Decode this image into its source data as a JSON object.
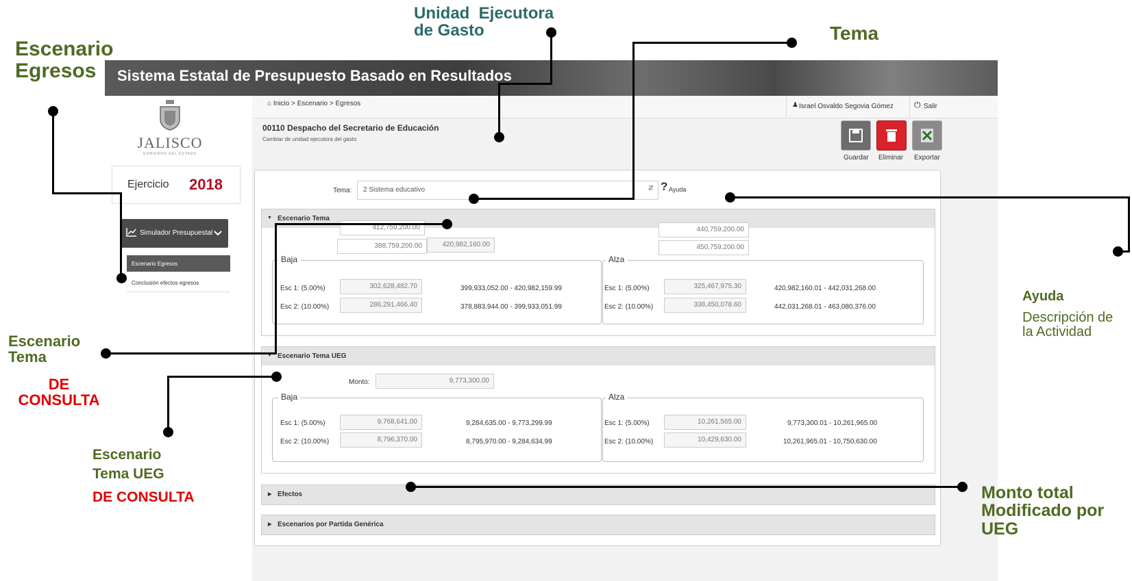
{
  "annotations": {
    "escenario_egresos": [
      "Escenario",
      "Egresos"
    ],
    "unidad_ejecutora": [
      "Unidad  Ejecutora",
      "de Gasto"
    ],
    "tema": "Tema",
    "escenario_tema": [
      "Escenario",
      "Tema"
    ],
    "de_consulta_1": [
      "DE",
      "CONSULTA"
    ],
    "escenario_tema_ueg": [
      "Escenario",
      "Tema UEG"
    ],
    "de_consulta_2": "DE CONSULTA",
    "ayuda": "Ayuda",
    "ayuda_desc": [
      "Descripción de",
      "la Actividad"
    ],
    "monto_total": [
      "Monto total",
      "Modificado por",
      "UEG"
    ]
  },
  "header": {
    "title": "Sistema Estatal de Presupuesto Basado en Resultados"
  },
  "sidebar": {
    "logo_name": "JALISCO",
    "logo_sub": "GOBIERNO DEL ESTADO",
    "ejercicio_label": "Ejercicio",
    "ejercicio_year": "2018",
    "menu_label": "Simulador Presupuestal",
    "items": [
      {
        "label": "Escenario Egresos"
      },
      {
        "label": "Conclusión efectos egresos"
      }
    ]
  },
  "breadcrumb": {
    "home": "Inicio",
    "level2": "> Escenario >",
    "level3": "Egresos"
  },
  "user": {
    "name": "Israel Osvaldo Segovia Gómez",
    "logout": "Salir"
  },
  "unit": {
    "title": "00110 Despacho del Secretario de Educación",
    "subtitle": "Cambiar de unidad ejecutora del gasto"
  },
  "toolbar": {
    "save": "Guardar",
    "delete": "Eliminar",
    "export": "Exportar"
  },
  "tema": {
    "label": "Tema:",
    "value": "2 Sistema educativo",
    "help": "Ayuda"
  },
  "escenario_tema": {
    "title": "Escenario Tema",
    "top_left": "412,759,200.00",
    "mid_left": "388,759,200.00",
    "mid_right": "420,982,160.00",
    "top_right": "440,759,200.00",
    "mid_right2": "450,759,200.00",
    "baja": {
      "legend": "Baja",
      "rows": [
        {
          "label": "Esc 1: (5.00%)",
          "value": "302,628,482.70",
          "range": "399,933,052.00 - 420,982,159.99"
        },
        {
          "label": "Esc 2: (10.00%)",
          "value": "286,291,466.40",
          "range": "378,883,944.00 - 399,933,051.99"
        }
      ]
    },
    "alza": {
      "legend": "Alza",
      "rows": [
        {
          "label": "Esc 1: (5.00%)",
          "value": "325,467,975.30",
          "range": "420,982,160.01 - 442,031,268.00"
        },
        {
          "label": "Esc 2: (10.00%)",
          "value": "338,450,078.60",
          "range": "442,031,268.01 - 463,080,376.00"
        }
      ]
    }
  },
  "escenario_tema_ueg": {
    "title": "Escenario Tema UEG",
    "monto_label": "Monto:",
    "monto": "9,773,300.00",
    "baja": {
      "legend": "Baja",
      "rows": [
        {
          "label": "Esc 1: (5.00%)",
          "value": "9,768,641.00",
          "range": "9,284,635.00 - 9,773,299.99"
        },
        {
          "label": "Esc 2: (10.00%)",
          "value": "8,796,370.00",
          "range": "8,795,970.00 - 9,284,634.99"
        }
      ]
    },
    "alza": {
      "legend": "Alza",
      "rows": [
        {
          "label": "Esc 1: (5.00%)",
          "value": "10,261,565.00",
          "range": "9,773,300.01 - 10,261,965.00"
        },
        {
          "label": "Esc 2: (10.00%)",
          "value": "10,429,630.00",
          "range": "10,261,965.01 - 10,750,630.00"
        }
      ]
    }
  },
  "efectos": {
    "title": "Efectos"
  },
  "partida": {
    "title": "Escenarios por Partida Genérica"
  },
  "colors": {
    "save": "#6d6d6d",
    "delete": "#d9222a",
    "export": "#8a8a8a",
    "menu": "#4a4a4a",
    "accent_year": "#b01020"
  }
}
